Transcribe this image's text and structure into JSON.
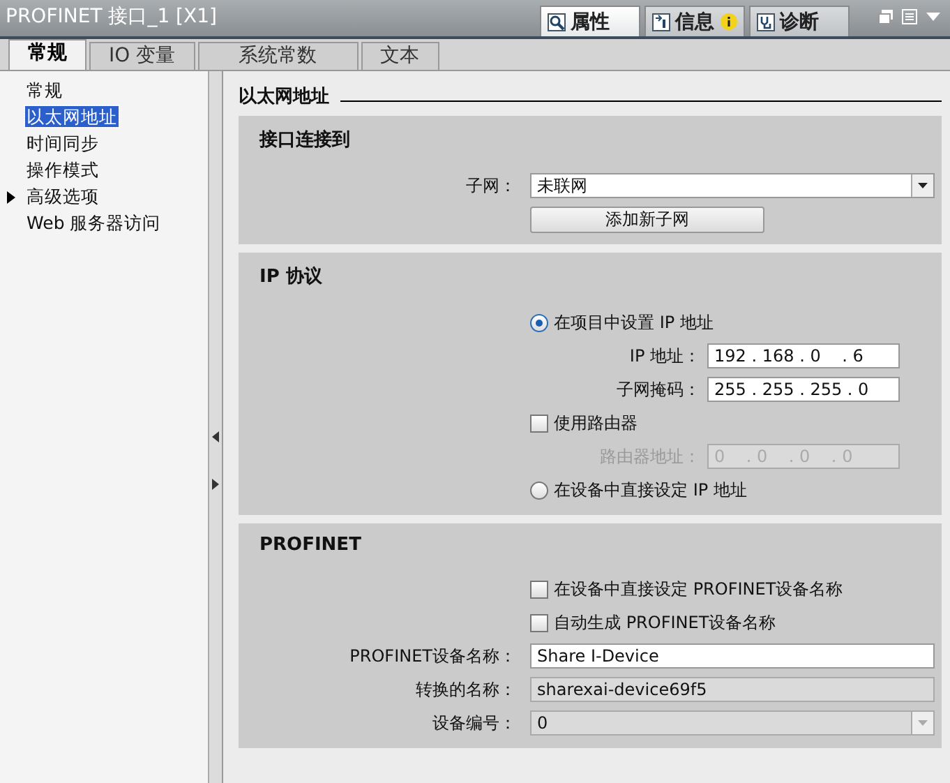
{
  "window": {
    "title": "PROFINET 接口_1 [X1]"
  },
  "inspector_tabs": [
    {
      "label": "属性",
      "selected": true,
      "kind": "properties"
    },
    {
      "label": "信息",
      "selected": false,
      "kind": "info"
    },
    {
      "label": "诊断",
      "selected": false,
      "kind": "diagnostics"
    }
  ],
  "tabs": [
    {
      "label": "常规",
      "selected": true
    },
    {
      "label": "IO 变量",
      "selected": false
    },
    {
      "label": "系统常数",
      "selected": false
    },
    {
      "label": "文本",
      "selected": false
    }
  ],
  "sidebar": {
    "items": [
      {
        "label": "常规",
        "selected": false,
        "expandable": false
      },
      {
        "label": "以太网地址",
        "selected": true,
        "expandable": false
      },
      {
        "label": "时间同步",
        "selected": false,
        "expandable": false
      },
      {
        "label": "操作模式",
        "selected": false,
        "expandable": false
      },
      {
        "label": "高级选项",
        "selected": false,
        "expandable": true
      },
      {
        "label": "Web 服务器访问",
        "selected": false,
        "expandable": false
      }
    ]
  },
  "page_title": "以太网地址",
  "sections": [
    {
      "title": "接口连接到",
      "rows": [
        {
          "kind": "dropdown",
          "label": "子网：",
          "value": "未联网",
          "disabled": false
        },
        {
          "kind": "button",
          "label": "添加新子网"
        }
      ]
    },
    {
      "title": "IP 协议",
      "rows": [
        {
          "kind": "radio",
          "label": "在项目中设置 IP 地址",
          "selected": true
        },
        {
          "kind": "ip_field",
          "label": "IP 地址：",
          "value": "192 . 168 . 0    . 6",
          "disabled": false
        },
        {
          "kind": "ip_field",
          "label": "子网掩码：",
          "value": "255 . 255 . 255 . 0",
          "disabled": false
        },
        {
          "kind": "checkbox",
          "label": "使用路由器",
          "checked": false
        },
        {
          "kind": "ip_field",
          "label": "路由器地址：",
          "value": "0    . 0    . 0    . 0",
          "disabled": true
        },
        {
          "kind": "radio",
          "label": "在设备中直接设定 IP 地址",
          "selected": false
        }
      ]
    },
    {
      "title": "PROFINET",
      "rows": [
        {
          "kind": "checkbox",
          "label": "在设备中直接设定 PROFINET设备名称",
          "checked": false
        },
        {
          "kind": "checkbox",
          "label": "自动生成 PROFINET设备名称",
          "checked": false
        },
        {
          "kind": "field",
          "label": "PROFINET设备名称：",
          "value": "Share I-Device",
          "disabled": false
        },
        {
          "kind": "field",
          "label": "转换的名称：",
          "value": "sharexai-device69f5",
          "disabled": true
        },
        {
          "kind": "dropdown",
          "label": "设备编号：",
          "value": "0",
          "disabled": true
        }
      ]
    }
  ]
}
